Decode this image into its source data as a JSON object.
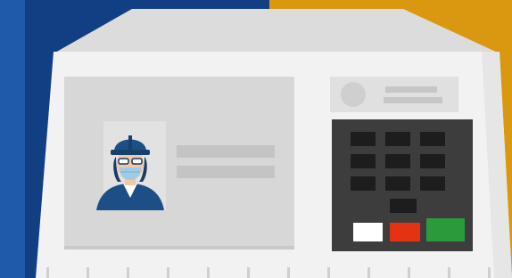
{
  "colors": {
    "background_blue": "#123f84",
    "background_blue_edge": "#1f5aa8",
    "background_gold": "#d9980f",
    "machine_lid": "#dcdcdc",
    "machine_body": "#f2f2f2",
    "machine_side": "#e6e6e6",
    "screen": "#d7d7d7",
    "keypad_bg": "#3d3d3d",
    "key": "#1d1d1d",
    "key_white": "#ffffff",
    "key_red": "#e33312",
    "key_green": "#2b9a3b",
    "figure_blue": "#1d4f86"
  },
  "icons": {
    "voter_figure": "hardhat-mask-voter-icon",
    "keypad": "keypad-icon"
  },
  "keypad": {
    "number_keys": 10,
    "action_keys": [
      "white",
      "red",
      "green"
    ]
  }
}
